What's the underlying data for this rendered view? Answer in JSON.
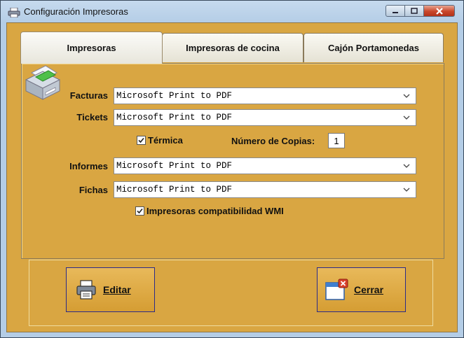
{
  "window": {
    "title": "Configuración Impresoras"
  },
  "tabs": [
    {
      "label": "Impresoras",
      "active": true
    },
    {
      "label": "Impresoras de cocina",
      "active": false
    },
    {
      "label": "Cajón Portamonedas",
      "active": false
    }
  ],
  "form": {
    "facturas": {
      "label": "Facturas",
      "value": "Microsoft Print to PDF"
    },
    "tickets": {
      "label": "Tickets",
      "value": "Microsoft Print to PDF"
    },
    "termica": {
      "label": "Térmica",
      "checked": true
    },
    "copias": {
      "label": "Número de Copias:",
      "value": "1"
    },
    "informes": {
      "label": "Informes",
      "value": "Microsoft Print to PDF"
    },
    "fichas": {
      "label": "Fichas",
      "value": "Microsoft Print to PDF"
    },
    "wmi": {
      "label": "Impresoras compatibilidad WMI",
      "checked": true
    }
  },
  "buttons": {
    "edit": "Editar",
    "close": "Cerrar"
  },
  "icons": {
    "title": "printer-icon",
    "panel": "printer-icon",
    "edit": "printer-icon",
    "close": "window-close-icon"
  },
  "colors": {
    "client_bg": "#d9a642",
    "close_button": "#c9472b"
  }
}
